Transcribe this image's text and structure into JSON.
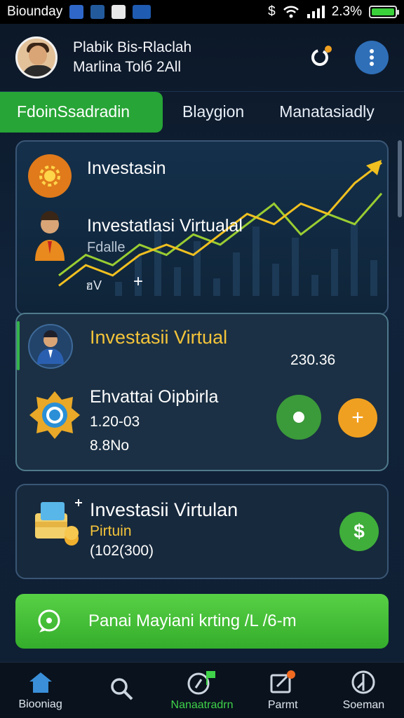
{
  "status_bar": {
    "carrier": "Biounday",
    "time_battery": "2.3%",
    "currency_glyph": "$",
    "battery_level": 1.0
  },
  "header": {
    "line1": "Plabik Bis-Rlaclah",
    "line2": "Marlina Tolб 2All"
  },
  "tabs": [
    {
      "label": "FdoinSsadradin",
      "active": true
    },
    {
      "label": "Blaygion",
      "active": false
    },
    {
      "label": "Manatasiadly",
      "active": false
    }
  ],
  "card1": {
    "title": "Investasin",
    "subtitle": "Investatlasi Virtualal",
    "caption": "Fdalle",
    "mini": "ฮV",
    "plus": "+",
    "chart_data": {
      "type": "line",
      "series": [
        {
          "color": "#9acd32",
          "values": [
            2,
            4,
            3,
            5,
            4,
            6,
            5,
            7,
            9,
            6,
            8,
            7,
            10
          ]
        },
        {
          "color": "#f0c020",
          "values": [
            1,
            3,
            2,
            4,
            5,
            4,
            6,
            8,
            7,
            9,
            8,
            11,
            13
          ]
        }
      ]
    }
  },
  "card2": {
    "title": "Investasii Virtual",
    "value": "230.36",
    "label": "Ehvattai Oipbirla",
    "line1": "1.20-03",
    "line2": "8.8No",
    "btn_plus": "+"
  },
  "card3": {
    "title": "Investasii Virtulan",
    "subtitle": "Pirtuin",
    "value": "(102(300)",
    "btn_symbol": "$"
  },
  "cta": {
    "label": "Panai Mayiani krting /L /6-m"
  },
  "nav": [
    {
      "label": "Biooniag",
      "icon": "home-icon",
      "active": false
    },
    {
      "label": "",
      "icon": "search-icon",
      "active": false
    },
    {
      "label": "Nanaatradrn",
      "icon": "flag-icon",
      "active": true
    },
    {
      "label": "Parmt",
      "icon": "edit-icon",
      "active": false
    },
    {
      "label": "Soeman",
      "icon": "compass-icon",
      "active": false
    }
  ],
  "colors": {
    "accent_green": "#27a536",
    "accent_orange": "#f0a020",
    "card_border": "#3a5675"
  }
}
